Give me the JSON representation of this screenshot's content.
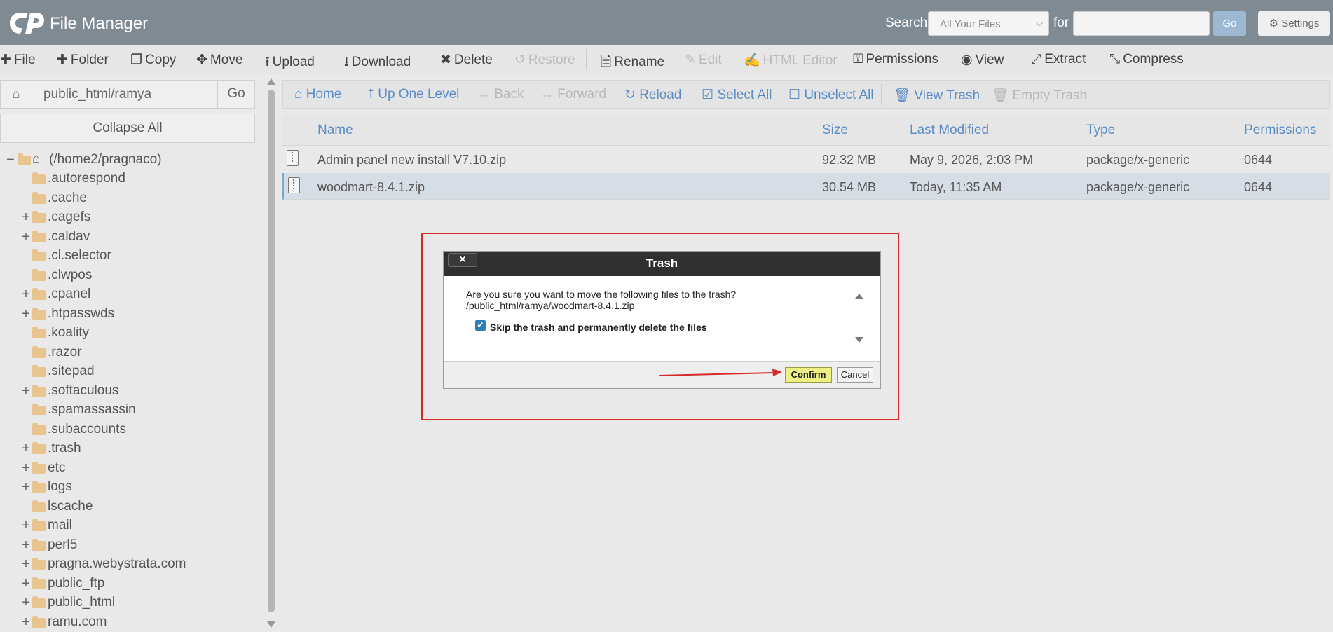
{
  "header": {
    "app_title": "File Manager",
    "search_label": "Search",
    "search_scope": "All Your Files",
    "for_label": "for",
    "search_value": "",
    "go_label": "Go",
    "settings_label": "Settings"
  },
  "toolbar": {
    "items": [
      {
        "label": "File",
        "icon": "plus-icon",
        "enabled": true
      },
      {
        "label": "Folder",
        "icon": "plus-icon",
        "enabled": true
      },
      {
        "label": "Copy",
        "icon": "copy-icon",
        "enabled": true
      },
      {
        "label": "Move",
        "icon": "move-icon",
        "enabled": true
      },
      {
        "label": "Upload",
        "icon": "upload-icon",
        "enabled": true
      },
      {
        "label": "Download",
        "icon": "download-icon",
        "enabled": true
      },
      {
        "label": "Delete",
        "icon": "close-icon",
        "enabled": true
      },
      {
        "label": "Restore",
        "icon": "undo-icon",
        "enabled": false
      },
      {
        "label": "Rename",
        "icon": "file-icon",
        "enabled": true
      },
      {
        "label": "Edit",
        "icon": "pencil-icon",
        "enabled": false
      },
      {
        "label": "HTML Editor",
        "icon": "edit-icon",
        "enabled": false
      },
      {
        "label": "Permissions",
        "icon": "key-icon",
        "enabled": true
      },
      {
        "label": "View",
        "icon": "eye-icon",
        "enabled": true
      },
      {
        "label": "Extract",
        "icon": "expand-icon",
        "enabled": true
      },
      {
        "label": "Compress",
        "icon": "compress-icon",
        "enabled": true
      }
    ]
  },
  "sidebar": {
    "path_value": "public_html/ramya",
    "go_label": "Go",
    "collapse_label": "Collapse All",
    "root_label": "(/home2/pragnaco)",
    "tree": [
      {
        "label": ".autorespond",
        "expandable": false
      },
      {
        "label": ".cache",
        "expandable": false
      },
      {
        "label": ".cagefs",
        "expandable": true
      },
      {
        "label": ".caldav",
        "expandable": true
      },
      {
        "label": ".cl.selector",
        "expandable": false
      },
      {
        "label": ".clwpos",
        "expandable": false
      },
      {
        "label": ".cpanel",
        "expandable": true
      },
      {
        "label": ".htpasswds",
        "expandable": true
      },
      {
        "label": ".koality",
        "expandable": false
      },
      {
        "label": ".razor",
        "expandable": false
      },
      {
        "label": ".sitepad",
        "expandable": false
      },
      {
        "label": ".softaculous",
        "expandable": true
      },
      {
        "label": ".spamassassin",
        "expandable": false
      },
      {
        "label": ".subaccounts",
        "expandable": false
      },
      {
        "label": ".trash",
        "expandable": true
      },
      {
        "label": "etc",
        "expandable": true
      },
      {
        "label": "logs",
        "expandable": true
      },
      {
        "label": "lscache",
        "expandable": false
      },
      {
        "label": "mail",
        "expandable": true
      },
      {
        "label": "perl5",
        "expandable": true
      },
      {
        "label": "pragna.webystrata.com",
        "expandable": true
      },
      {
        "label": "public_ftp",
        "expandable": true
      },
      {
        "label": "public_html",
        "expandable": true
      },
      {
        "label": "ramu.com",
        "expandable": true
      }
    ]
  },
  "navbar": {
    "items": [
      {
        "label": "Home",
        "icon": "home-icon",
        "enabled": true
      },
      {
        "label": "Up One Level",
        "icon": "level-up-icon",
        "enabled": true
      },
      {
        "label": "Back",
        "icon": "arrow-left-icon",
        "enabled": false
      },
      {
        "label": "Forward",
        "icon": "arrow-right-icon",
        "enabled": false
      },
      {
        "label": "Reload",
        "icon": "refresh-icon",
        "enabled": true
      },
      {
        "label": "Select All",
        "icon": "checkbox-checked-icon",
        "enabled": true
      },
      {
        "label": "Unselect All",
        "icon": "checkbox-empty-icon",
        "enabled": true
      },
      {
        "label": "View Trash",
        "icon": "trash-icon",
        "enabled": true
      },
      {
        "label": "Empty Trash",
        "icon": "trash-icon",
        "enabled": false
      }
    ]
  },
  "table": {
    "columns": [
      "Name",
      "Size",
      "Last Modified",
      "Type",
      "Permissions"
    ],
    "rows": [
      {
        "name": "Admin panel new install V7.10.zip",
        "size": "92.32 MB",
        "modified": "May 9, 2026, 2:03 PM",
        "type": "package/x-generic",
        "perms": "0644",
        "selected": false
      },
      {
        "name": "woodmart-8.4.1.zip",
        "size": "30.54 MB",
        "modified": "Today, 11:35 AM",
        "type": "package/x-generic",
        "perms": "0644",
        "selected": true
      }
    ]
  },
  "dialog": {
    "title": "Trash",
    "close_label": "×",
    "message_line1": "Are you sure you want to move the following files to the trash?",
    "message_line2": "/public_html/ramya/woodmart-8.4.1.zip",
    "checkbox_label": "Skip the trash and permanently delete the files",
    "checkbox_checked": true,
    "confirm_label": "Confirm",
    "cancel_label": "Cancel"
  },
  "colors": {
    "header_bg": "#7f8a93",
    "link_blue": "#5a8dc8",
    "highlight_red": "#d42a2a",
    "confirm_bg": "#eef084"
  }
}
